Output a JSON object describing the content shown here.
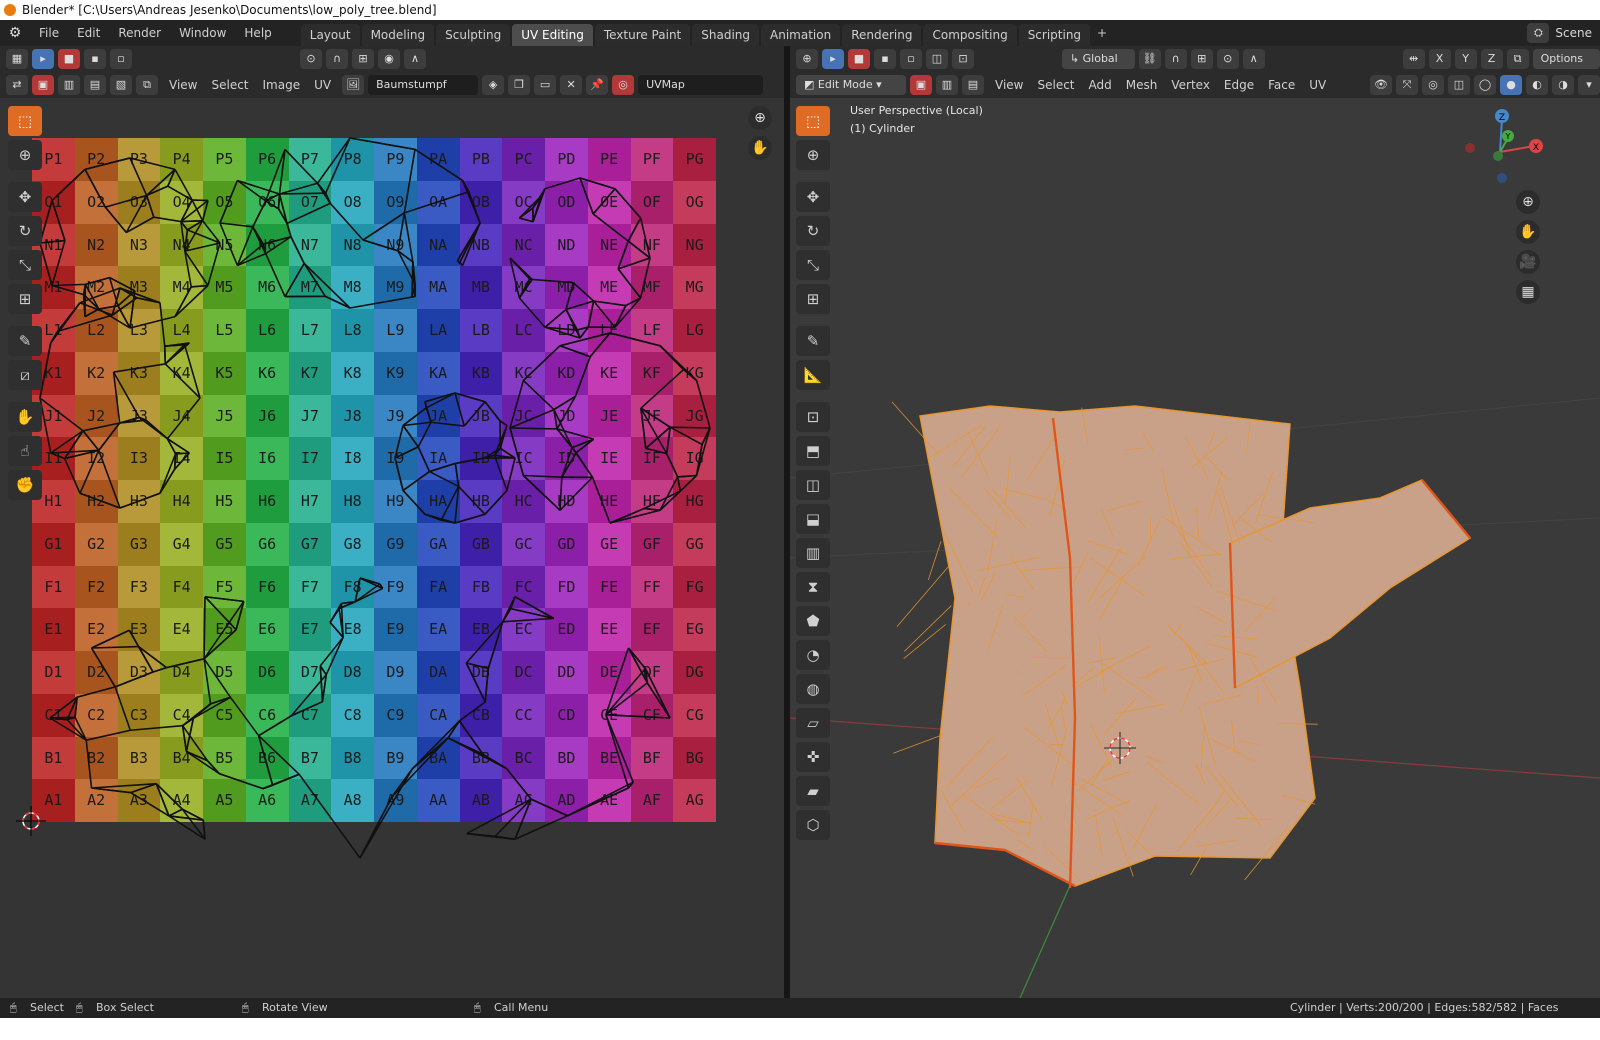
{
  "window": {
    "title": "Blender* [C:\\Users\\Andreas Jesenko\\Documents\\low_poly_tree.blend]"
  },
  "menu": [
    "File",
    "Edit",
    "Render",
    "Window",
    "Help"
  ],
  "workspaces": [
    "Layout",
    "Modeling",
    "Sculpting",
    "UV Editing",
    "Texture Paint",
    "Shading",
    "Animation",
    "Rendering",
    "Compositing",
    "Scripting"
  ],
  "active_workspace": "UV Editing",
  "scene_label": "Scene",
  "uv_editor": {
    "menus": [
      "View",
      "Select",
      "Image",
      "UV"
    ],
    "image_name": "Baumstumpf",
    "uv_map": "UVMap",
    "tools": [
      "select-box",
      "cursor",
      "move",
      "rotate",
      "scale",
      "transform",
      "annotate",
      "rip",
      "grab",
      "relax",
      "pinch"
    ],
    "grid_rows": [
      "P",
      "O",
      "N",
      "M",
      "L",
      "K",
      "J",
      "I",
      "H",
      "G",
      "F",
      "E",
      "D",
      "C",
      "B",
      "A"
    ],
    "grid_cols": [
      "1",
      "2",
      "3",
      "4",
      "5",
      "6",
      "7",
      "8",
      "9",
      "A",
      "B",
      "C",
      "D",
      "E",
      "F",
      "G"
    ],
    "checker_colors": [
      "#c43b3b",
      "#c4703b",
      "#b89a3b",
      "#a3b83b",
      "#6db83b",
      "#3bb85a",
      "#3bb89a",
      "#3bafc4",
      "#3b86c4",
      "#3b5bc4",
      "#5a3bc4",
      "#863bc4",
      "#a83bc4",
      "#c43bb3",
      "#c43b86",
      "#c43b5b"
    ]
  },
  "viewport": {
    "global": "Global",
    "options": "Options",
    "mode": "Edit Mode",
    "menus": [
      "View",
      "Select",
      "Add",
      "Mesh",
      "Vertex",
      "Edge",
      "Face",
      "UV"
    ],
    "axes": [
      "X",
      "Y",
      "Z"
    ],
    "perspective": "User Perspective (Local)",
    "object": "(1) Cylinder",
    "tools": [
      "select-box",
      "cursor",
      "move",
      "rotate",
      "scale",
      "transform",
      "annotate",
      "measure",
      "add-cube",
      "extrude",
      "inset",
      "bevel",
      "loop-cut",
      "knife",
      "poly-build",
      "spin",
      "smooth",
      "edge-slide",
      "shrink-fatten",
      "shear",
      "rip-region"
    ],
    "gizmo_labels": {
      "x": "X",
      "y": "Y",
      "z": "Z"
    },
    "mesh_color": "#c9a189",
    "edge_color": "#e8962f",
    "seam_color": "#e0561a"
  },
  "statusbar": {
    "select": "Select",
    "box_select": "Box Select",
    "rotate_view": "Rotate View",
    "call_menu": "Call Menu",
    "stats": "Cylinder | Verts:200/200 | Edges:582/582 | Faces"
  }
}
